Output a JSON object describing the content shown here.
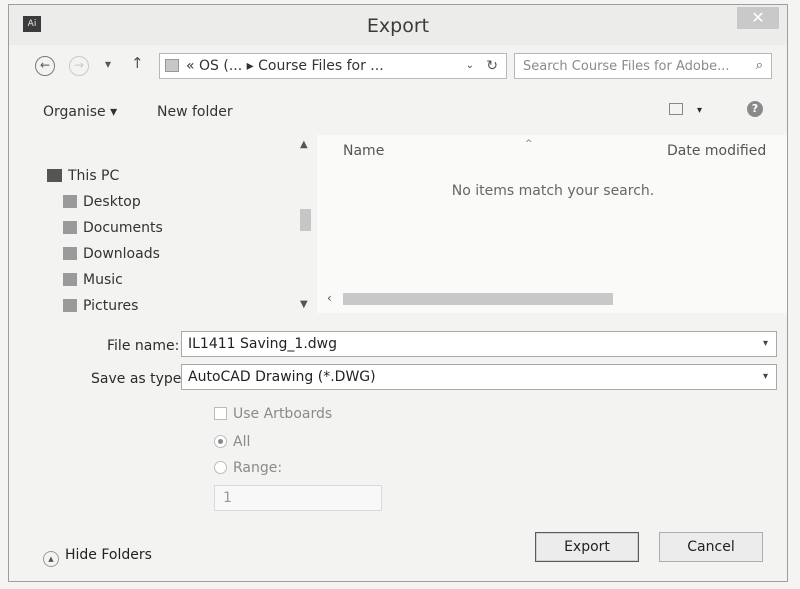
{
  "window": {
    "title": "Export",
    "app_icon": "Ai",
    "close_glyph": "✕"
  },
  "address_bar": {
    "back_glyph": "←",
    "forward_glyph": "→",
    "recent_glyph": "▾",
    "up_glyph": "↑",
    "path_text": "«  OS (...  ▸  Course Files for ...",
    "dropdown_glyph": "⌄",
    "refresh_glyph": "↻"
  },
  "search": {
    "placeholder": "Search Course Files for Adobe...",
    "icon_glyph": "⌕"
  },
  "toolbar": {
    "organise_label": "Organise ▾",
    "new_folder_label": "New folder",
    "view_dropdown_glyph": "▾",
    "help_glyph": "?"
  },
  "nav_pane": {
    "items": [
      {
        "label": "This PC",
        "icon": "computer-icon"
      },
      {
        "label": "Desktop",
        "icon": "desktop-folder-icon"
      },
      {
        "label": "Documents",
        "icon": "documents-folder-icon"
      },
      {
        "label": "Downloads",
        "icon": "downloads-folder-icon"
      },
      {
        "label": "Music",
        "icon": "music-folder-icon"
      },
      {
        "label": "Pictures",
        "icon": "pictures-folder-icon"
      }
    ]
  },
  "file_list": {
    "columns": [
      "Name",
      "Date modified"
    ],
    "sort_glyph": "^",
    "empty_message": "No items match your search."
  },
  "form": {
    "file_name_label": "File name:",
    "file_name_value": "IL1411 Saving_1.dwg",
    "save_type_label": "Save as type:",
    "save_type_value": "AutoCAD Drawing (*.DWG)",
    "use_artboards_label": "Use Artboards",
    "all_label": "All",
    "range_label": "Range:",
    "range_value": "1"
  },
  "footer": {
    "hide_folders_label": "Hide Folders",
    "export_label": "Export",
    "cancel_label": "Cancel"
  }
}
